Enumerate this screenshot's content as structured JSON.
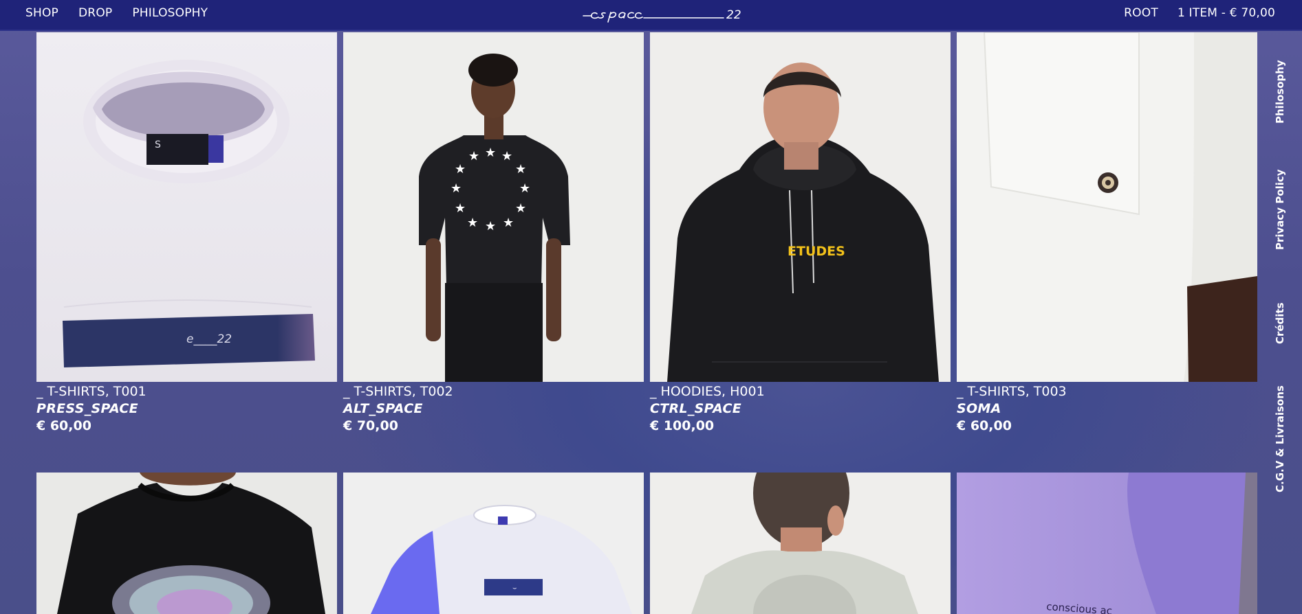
{
  "header": {
    "nav_left": [
      "SHOP",
      "DROP",
      "PHILOSOPHY"
    ],
    "logo_text": "espace____22",
    "nav_right": {
      "account": "ROOT",
      "cart": "1 ITEM - € 70,00"
    }
  },
  "sidebar": {
    "links": [
      "Philosophy",
      "Privacy Policy",
      "Crédits",
      "C.G.V & Livraisons"
    ]
  },
  "products": [
    {
      "category": "_ T-SHIRTS, T001",
      "name": "PRESS_SPACE",
      "price": "€ 60,00",
      "label_text": "e____22"
    },
    {
      "category": "_ T-SHIRTS, T002",
      "name": "ALT_SPACE",
      "price": "€ 70,00"
    },
    {
      "category": "_ HOODIES, H001",
      "name": "CTRL_SPACE",
      "price": "€ 100,00",
      "print_text": "ETUDES"
    },
    {
      "category": "_ T-SHIRTS, T003",
      "name": "SOMA",
      "price": "€ 60,00"
    }
  ],
  "products_row2_images": [
    "black-tee-photo",
    "white-tee-3d-photo",
    "grey-hoodie-back-photo",
    "lilac-fabric-photo"
  ],
  "row2_print_text": "conscious ac",
  "colors": {
    "header_bg": "#1f2379",
    "page_bg": "#4b5394"
  }
}
